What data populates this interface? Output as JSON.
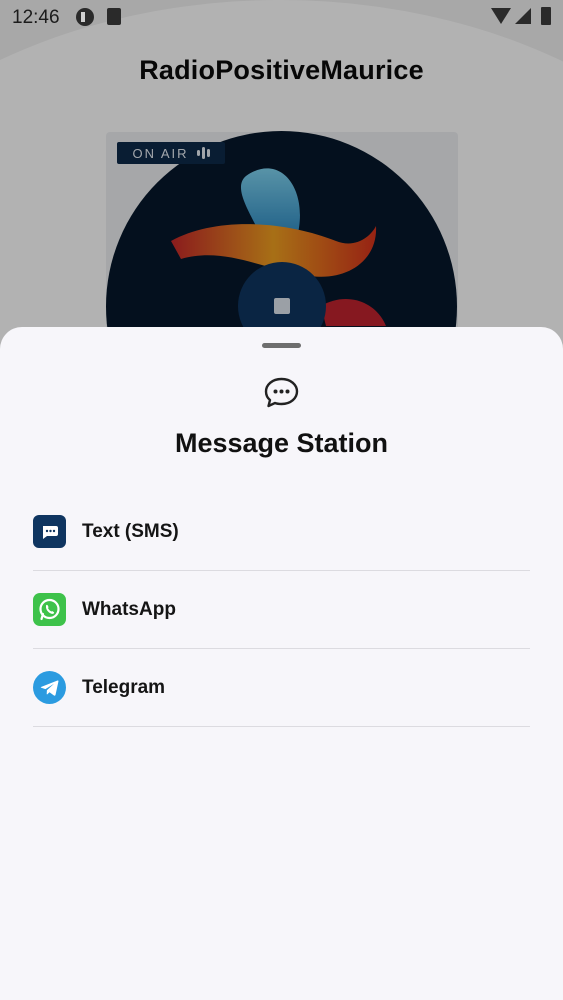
{
  "status_bar": {
    "time": "12:46"
  },
  "app": {
    "title": "RadioPositiveMaurice",
    "on_air_label": "ON AIR"
  },
  "sheet": {
    "title": "Message Station",
    "icon": "chat-bubble-icon",
    "options": [
      {
        "label": "Text (SMS)",
        "icon": "sms-icon",
        "color": "#0f3560"
      },
      {
        "label": "WhatsApp",
        "icon": "whatsapp-icon",
        "color": "#3ec24a"
      },
      {
        "label": "Telegram",
        "icon": "telegram-icon",
        "color": "#2b9be0"
      }
    ]
  },
  "nav": {
    "back_icon": "back-icon",
    "home_icon": "home-icon",
    "recent_icon": "recent-apps-icon"
  }
}
